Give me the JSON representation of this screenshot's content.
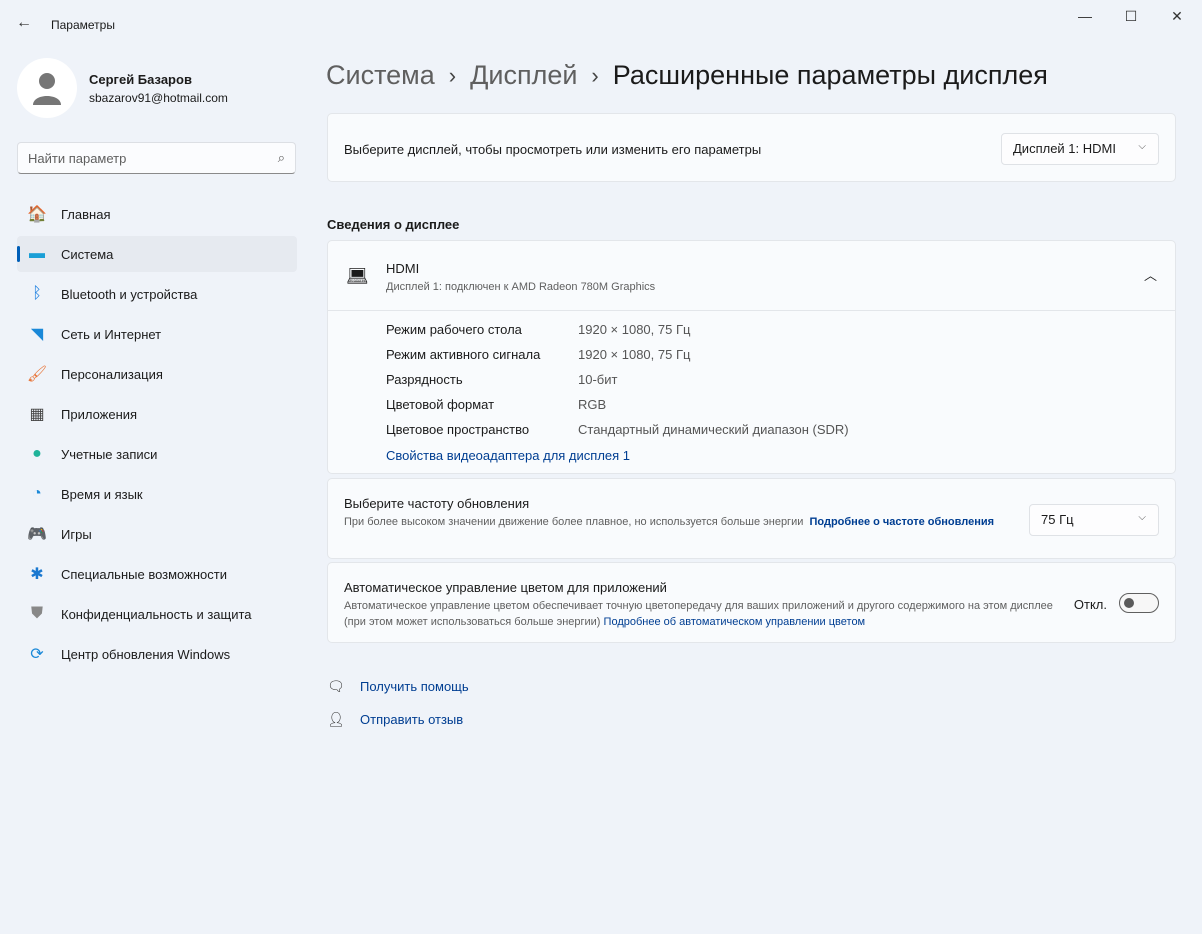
{
  "window": {
    "title": "Параметры",
    "minimize": "—",
    "maximize": "☐",
    "close": "✕"
  },
  "profile": {
    "name": "Сергей Базаров",
    "email": "sbazarov91@hotmail.com"
  },
  "search": {
    "placeholder": "Найти параметр"
  },
  "nav": [
    {
      "label": "Главная",
      "icon": "🏠",
      "color": "#e8763a"
    },
    {
      "label": "Система",
      "icon": "▬",
      "color": "#1a9fd6"
    },
    {
      "label": "Bluetooth и устройства",
      "icon": "ᛒ",
      "color": "#1c7fe0"
    },
    {
      "label": "Сеть и Интернет",
      "icon": "◥",
      "color": "#1a88d8"
    },
    {
      "label": "Персонализация",
      "icon": "🖌",
      "color": "#e8763a"
    },
    {
      "label": "Приложения",
      "icon": "▦",
      "color": "#444"
    },
    {
      "label": "Учетные записи",
      "icon": "●",
      "color": "#1fb39a"
    },
    {
      "label": "Время и язык",
      "icon": "◔",
      "color": "#1a88d8"
    },
    {
      "label": "Игры",
      "icon": "🎮",
      "color": "#888"
    },
    {
      "label": "Специальные возможности",
      "icon": "✱",
      "color": "#1a78d0"
    },
    {
      "label": "Конфиденциальность и защита",
      "icon": "⛊",
      "color": "#888"
    },
    {
      "label": "Центр обновления Windows",
      "icon": "⟳",
      "color": "#1a88d8"
    }
  ],
  "breadcrumb": {
    "items": [
      "Система",
      "Дисплей"
    ],
    "current": "Расширенные параметры дисплея",
    "sep": "›"
  },
  "select_display": {
    "label": "Выберите дисплей, чтобы просмотреть или изменить его параметры",
    "value": "Дисплей 1: HDMI"
  },
  "section_title": "Сведения о дисплее",
  "display_info": {
    "name": "HDMI",
    "subtitle": "Дисплей 1: подключен к AMD Radeon 780M Graphics",
    "rows": [
      {
        "k": "Режим рабочего стола",
        "v": "1920 × 1080, 75 Гц"
      },
      {
        "k": "Режим активного сигнала",
        "v": "1920 × 1080, 75 Гц"
      },
      {
        "k": "Разрядность",
        "v": "10-бит"
      },
      {
        "k": "Цветовой формат",
        "v": "RGB"
      },
      {
        "k": "Цветовое пространство",
        "v": "Стандартный динамический диапазон (SDR)"
      }
    ],
    "link": "Свойства видеоадаптера для дисплея 1"
  },
  "refresh": {
    "title": "Выберите частоту обновления",
    "desc": "При более высоком значении движение более плавное, но используется больше энергии",
    "link": "Подробнее о частоте обновления",
    "value": "75 Гц"
  },
  "acm": {
    "title": "Автоматическое управление цветом для приложений",
    "desc": "Автоматическое управление цветом обеспечивает точную цветопередачу для ваших приложений и другого содержимого на этом дисплее (при этом может использоваться больше энергии)",
    "link": "Подробнее об автоматическом управлении цветом",
    "state": "Откл."
  },
  "help": {
    "get_help": "Получить помощь",
    "feedback": "Отправить отзыв"
  }
}
